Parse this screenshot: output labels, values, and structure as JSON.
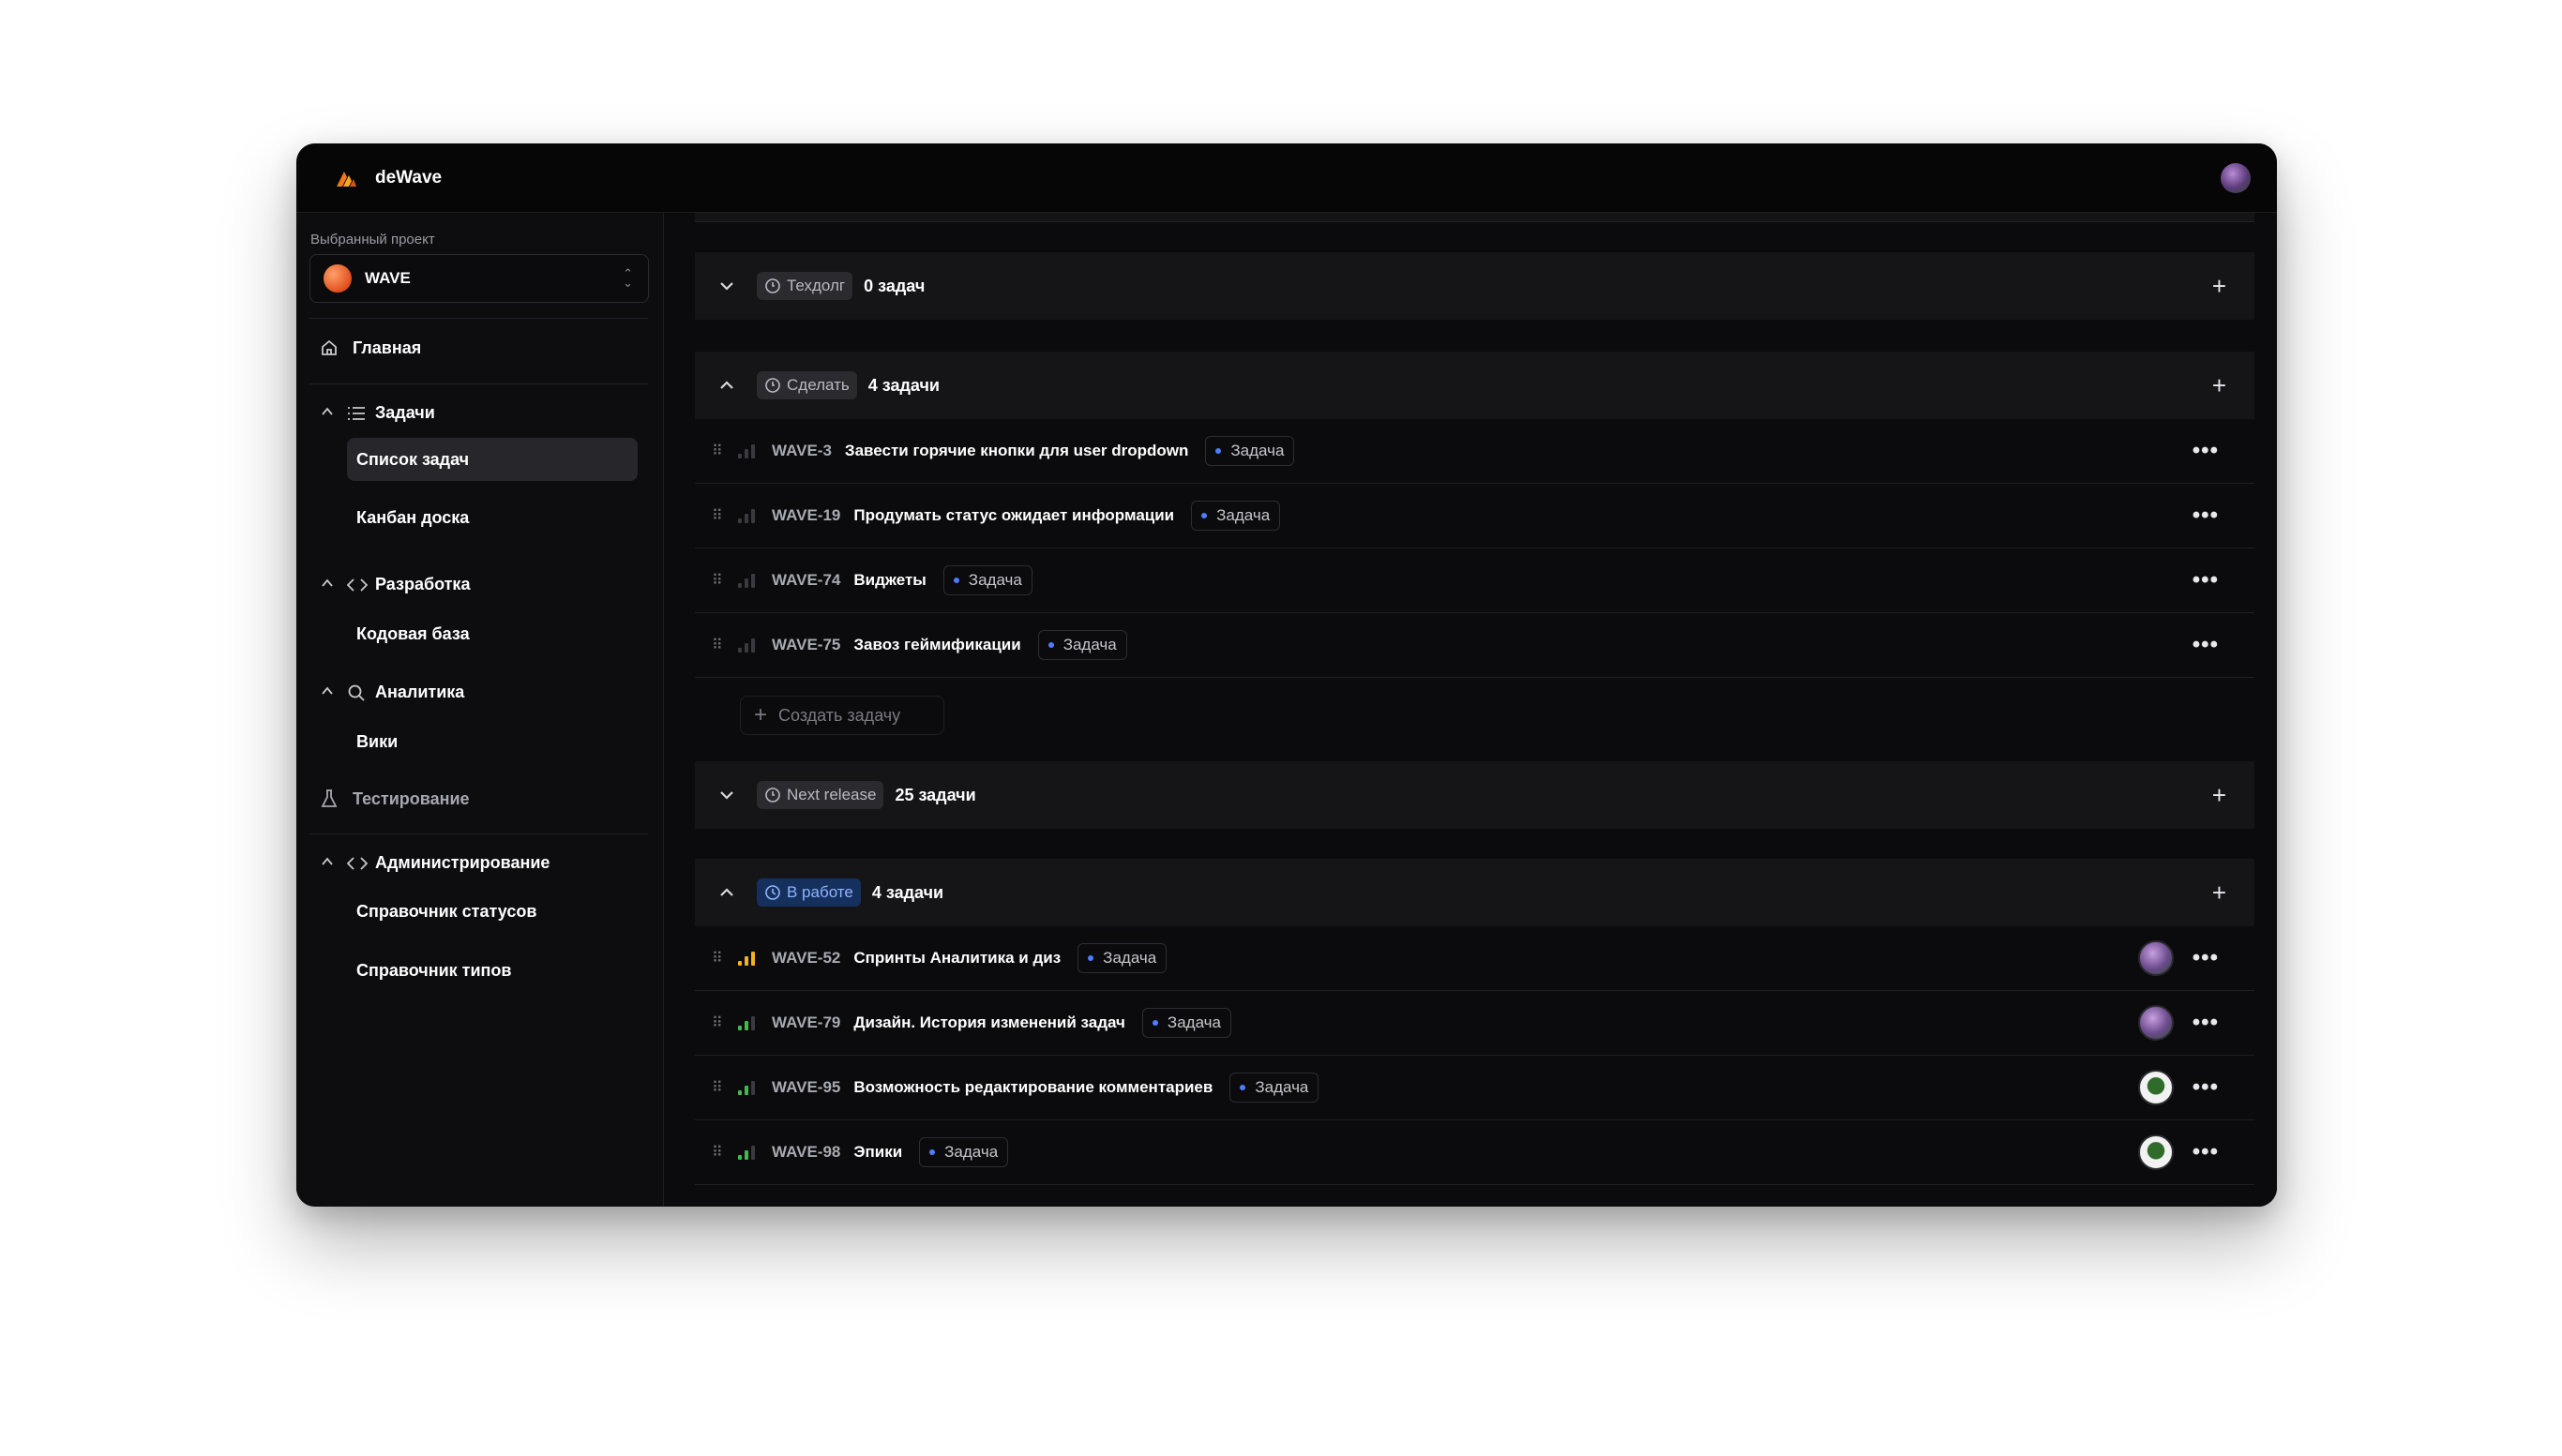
{
  "app": {
    "name": "deWave"
  },
  "sidebar": {
    "project_label": "Выбранный проект",
    "project_name": "WAVE",
    "home": "Главная",
    "tasks_section": "Задачи",
    "task_list": "Список задач",
    "kanban": "Канбан доска",
    "dev_section": "Разработка",
    "codebase": "Кодовая база",
    "analytics_section": "Аналитика",
    "wiki": "Вики",
    "testing": "Тестирование",
    "admin_section": "Администрирование",
    "status_dir": "Справочник статусов",
    "type_dir": "Справочник типов"
  },
  "groups": [
    {
      "status": "Техдолг",
      "count": "0 задач",
      "expanded": false
    },
    {
      "status": "Сделать",
      "count": "4 задачи",
      "expanded": true
    },
    {
      "status": "Next release",
      "count": "25 задачи",
      "expanded": false
    },
    {
      "status": "В работе",
      "count": "4 задачи",
      "expanded": true
    }
  ],
  "todo_tasks": [
    {
      "id": "WAVE-3",
      "title": "Завести горячие кнопки для user dropdown",
      "type": "Задача"
    },
    {
      "id": "WAVE-19",
      "title": "Продумать статус ожидает информации",
      "type": "Задача"
    },
    {
      "id": "WAVE-74",
      "title": "Виджеты",
      "type": "Задача"
    },
    {
      "id": "WAVE-75",
      "title": "Завоз геймификации",
      "type": "Задача"
    }
  ],
  "inprogress_tasks": [
    {
      "id": "WAVE-52",
      "title": "Спринты Аналитика и диз",
      "type": "Задача"
    },
    {
      "id": "WAVE-79",
      "title": "Дизайн. История изменений задач",
      "type": "Задача"
    },
    {
      "id": "WAVE-95",
      "title": "Возможность редактирование комментариев",
      "type": "Задача"
    },
    {
      "id": "WAVE-98",
      "title": "Эпики",
      "type": "Задача"
    }
  ],
  "create_task": "Создать задачу",
  "colors": {
    "accent_blue": "#4d7dff",
    "priority_high": "#f2b21b",
    "priority_medium": "#3fb950",
    "in_progress_bg": "#16305e"
  }
}
